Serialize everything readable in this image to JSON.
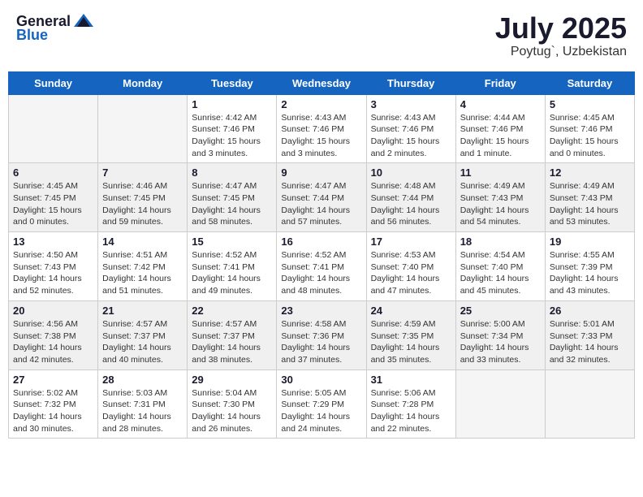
{
  "logo": {
    "general": "General",
    "blue": "Blue"
  },
  "title": "July 2025",
  "location": "Poytug`, Uzbekistan",
  "days_of_week": [
    "Sunday",
    "Monday",
    "Tuesday",
    "Wednesday",
    "Thursday",
    "Friday",
    "Saturday"
  ],
  "weeks": [
    {
      "shaded": false,
      "days": [
        {
          "num": "",
          "empty": true,
          "sunrise": "",
          "sunset": "",
          "daylight": ""
        },
        {
          "num": "",
          "empty": true,
          "sunrise": "",
          "sunset": "",
          "daylight": ""
        },
        {
          "num": "1",
          "empty": false,
          "sunrise": "Sunrise: 4:42 AM",
          "sunset": "Sunset: 7:46 PM",
          "daylight": "Daylight: 15 hours and 3 minutes."
        },
        {
          "num": "2",
          "empty": false,
          "sunrise": "Sunrise: 4:43 AM",
          "sunset": "Sunset: 7:46 PM",
          "daylight": "Daylight: 15 hours and 3 minutes."
        },
        {
          "num": "3",
          "empty": false,
          "sunrise": "Sunrise: 4:43 AM",
          "sunset": "Sunset: 7:46 PM",
          "daylight": "Daylight: 15 hours and 2 minutes."
        },
        {
          "num": "4",
          "empty": false,
          "sunrise": "Sunrise: 4:44 AM",
          "sunset": "Sunset: 7:46 PM",
          "daylight": "Daylight: 15 hours and 1 minute."
        },
        {
          "num": "5",
          "empty": false,
          "sunrise": "Sunrise: 4:45 AM",
          "sunset": "Sunset: 7:46 PM",
          "daylight": "Daylight: 15 hours and 0 minutes."
        }
      ]
    },
    {
      "shaded": true,
      "days": [
        {
          "num": "6",
          "empty": false,
          "sunrise": "Sunrise: 4:45 AM",
          "sunset": "Sunset: 7:45 PM",
          "daylight": "Daylight: 15 hours and 0 minutes."
        },
        {
          "num": "7",
          "empty": false,
          "sunrise": "Sunrise: 4:46 AM",
          "sunset": "Sunset: 7:45 PM",
          "daylight": "Daylight: 14 hours and 59 minutes."
        },
        {
          "num": "8",
          "empty": false,
          "sunrise": "Sunrise: 4:47 AM",
          "sunset": "Sunset: 7:45 PM",
          "daylight": "Daylight: 14 hours and 58 minutes."
        },
        {
          "num": "9",
          "empty": false,
          "sunrise": "Sunrise: 4:47 AM",
          "sunset": "Sunset: 7:44 PM",
          "daylight": "Daylight: 14 hours and 57 minutes."
        },
        {
          "num": "10",
          "empty": false,
          "sunrise": "Sunrise: 4:48 AM",
          "sunset": "Sunset: 7:44 PM",
          "daylight": "Daylight: 14 hours and 56 minutes."
        },
        {
          "num": "11",
          "empty": false,
          "sunrise": "Sunrise: 4:49 AM",
          "sunset": "Sunset: 7:43 PM",
          "daylight": "Daylight: 14 hours and 54 minutes."
        },
        {
          "num": "12",
          "empty": false,
          "sunrise": "Sunrise: 4:49 AM",
          "sunset": "Sunset: 7:43 PM",
          "daylight": "Daylight: 14 hours and 53 minutes."
        }
      ]
    },
    {
      "shaded": false,
      "days": [
        {
          "num": "13",
          "empty": false,
          "sunrise": "Sunrise: 4:50 AM",
          "sunset": "Sunset: 7:43 PM",
          "daylight": "Daylight: 14 hours and 52 minutes."
        },
        {
          "num": "14",
          "empty": false,
          "sunrise": "Sunrise: 4:51 AM",
          "sunset": "Sunset: 7:42 PM",
          "daylight": "Daylight: 14 hours and 51 minutes."
        },
        {
          "num": "15",
          "empty": false,
          "sunrise": "Sunrise: 4:52 AM",
          "sunset": "Sunset: 7:41 PM",
          "daylight": "Daylight: 14 hours and 49 minutes."
        },
        {
          "num": "16",
          "empty": false,
          "sunrise": "Sunrise: 4:52 AM",
          "sunset": "Sunset: 7:41 PM",
          "daylight": "Daylight: 14 hours and 48 minutes."
        },
        {
          "num": "17",
          "empty": false,
          "sunrise": "Sunrise: 4:53 AM",
          "sunset": "Sunset: 7:40 PM",
          "daylight": "Daylight: 14 hours and 47 minutes."
        },
        {
          "num": "18",
          "empty": false,
          "sunrise": "Sunrise: 4:54 AM",
          "sunset": "Sunset: 7:40 PM",
          "daylight": "Daylight: 14 hours and 45 minutes."
        },
        {
          "num": "19",
          "empty": false,
          "sunrise": "Sunrise: 4:55 AM",
          "sunset": "Sunset: 7:39 PM",
          "daylight": "Daylight: 14 hours and 43 minutes."
        }
      ]
    },
    {
      "shaded": true,
      "days": [
        {
          "num": "20",
          "empty": false,
          "sunrise": "Sunrise: 4:56 AM",
          "sunset": "Sunset: 7:38 PM",
          "daylight": "Daylight: 14 hours and 42 minutes."
        },
        {
          "num": "21",
          "empty": false,
          "sunrise": "Sunrise: 4:57 AM",
          "sunset": "Sunset: 7:37 PM",
          "daylight": "Daylight: 14 hours and 40 minutes."
        },
        {
          "num": "22",
          "empty": false,
          "sunrise": "Sunrise: 4:57 AM",
          "sunset": "Sunset: 7:37 PM",
          "daylight": "Daylight: 14 hours and 38 minutes."
        },
        {
          "num": "23",
          "empty": false,
          "sunrise": "Sunrise: 4:58 AM",
          "sunset": "Sunset: 7:36 PM",
          "daylight": "Daylight: 14 hours and 37 minutes."
        },
        {
          "num": "24",
          "empty": false,
          "sunrise": "Sunrise: 4:59 AM",
          "sunset": "Sunset: 7:35 PM",
          "daylight": "Daylight: 14 hours and 35 minutes."
        },
        {
          "num": "25",
          "empty": false,
          "sunrise": "Sunrise: 5:00 AM",
          "sunset": "Sunset: 7:34 PM",
          "daylight": "Daylight: 14 hours and 33 minutes."
        },
        {
          "num": "26",
          "empty": false,
          "sunrise": "Sunrise: 5:01 AM",
          "sunset": "Sunset: 7:33 PM",
          "daylight": "Daylight: 14 hours and 32 minutes."
        }
      ]
    },
    {
      "shaded": false,
      "days": [
        {
          "num": "27",
          "empty": false,
          "sunrise": "Sunrise: 5:02 AM",
          "sunset": "Sunset: 7:32 PM",
          "daylight": "Daylight: 14 hours and 30 minutes."
        },
        {
          "num": "28",
          "empty": false,
          "sunrise": "Sunrise: 5:03 AM",
          "sunset": "Sunset: 7:31 PM",
          "daylight": "Daylight: 14 hours and 28 minutes."
        },
        {
          "num": "29",
          "empty": false,
          "sunrise": "Sunrise: 5:04 AM",
          "sunset": "Sunset: 7:30 PM",
          "daylight": "Daylight: 14 hours and 26 minutes."
        },
        {
          "num": "30",
          "empty": false,
          "sunrise": "Sunrise: 5:05 AM",
          "sunset": "Sunset: 7:29 PM",
          "daylight": "Daylight: 14 hours and 24 minutes."
        },
        {
          "num": "31",
          "empty": false,
          "sunrise": "Sunrise: 5:06 AM",
          "sunset": "Sunset: 7:28 PM",
          "daylight": "Daylight: 14 hours and 22 minutes."
        },
        {
          "num": "",
          "empty": true,
          "sunrise": "",
          "sunset": "",
          "daylight": ""
        },
        {
          "num": "",
          "empty": true,
          "sunrise": "",
          "sunset": "",
          "daylight": ""
        }
      ]
    }
  ]
}
